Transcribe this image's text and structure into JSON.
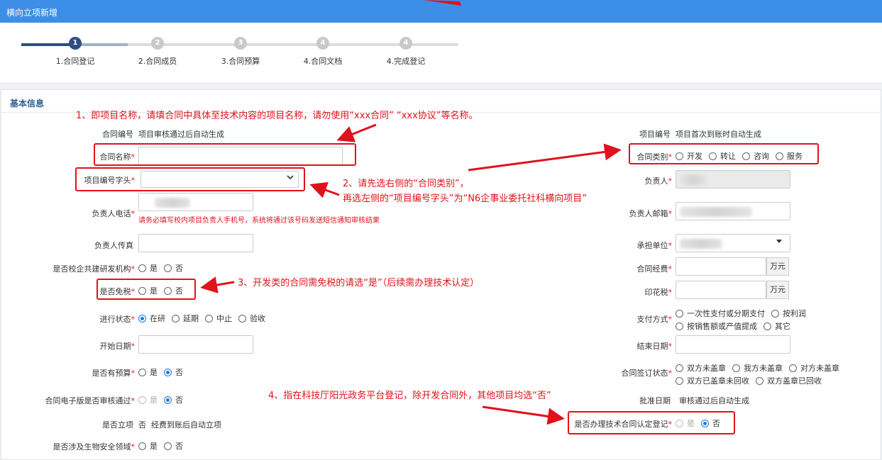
{
  "window": {
    "title": "横向立项新增"
  },
  "steps": [
    {
      "num": "1",
      "label": "1.合同登记"
    },
    {
      "num": "2",
      "label": "2.合同成员"
    },
    {
      "num": "3",
      "label": "3.合同预算"
    },
    {
      "num": "4",
      "label": "4.合同文档"
    },
    {
      "num": "4",
      "label": "4.完成登记"
    }
  ],
  "section": {
    "title": "基本信息"
  },
  "left": {
    "contract_no": {
      "label": "合同编号",
      "value": "项目审核通过后自动生成"
    },
    "contract_name": {
      "label": "合同名称",
      "value": ""
    },
    "project_prefix": {
      "label": "项目编号字头",
      "value": ""
    },
    "leader_phone": {
      "label": "负责人电话",
      "hint": "请务必填写校内项目负责人手机号，系统将通过该号码发送短信通知审核结果"
    },
    "leader_fax": {
      "label": "负责人传真",
      "value": ""
    },
    "joint_rd": {
      "label": "是否校企共建研发机构",
      "options": [
        "是",
        "否"
      ]
    },
    "tax_free": {
      "label": "是否免税",
      "options": [
        "是",
        "否"
      ]
    },
    "status": {
      "label": "进行状态",
      "options": [
        "在研",
        "延期",
        "中止",
        "验收"
      ]
    },
    "start_date": {
      "label": "开始日期",
      "value": ""
    },
    "has_budget": {
      "label": "是否有预算",
      "options": [
        "是",
        "否"
      ]
    },
    "e_version": {
      "label": "合同电子版是否审核通过",
      "options": [
        "是",
        "否"
      ]
    },
    "established": {
      "label": "是否立项",
      "value": "否",
      "note": "经费到账后自动立项"
    },
    "biosafety": {
      "label": "是否涉及生物安全领域",
      "options": [
        "是",
        "否"
      ]
    }
  },
  "right": {
    "project_no": {
      "label": "项目编号",
      "value": "项目首次到账时自动生成"
    },
    "contract_type": {
      "label": "合同类别",
      "options": [
        "开发",
        "转让",
        "咨询",
        "服务"
      ]
    },
    "leader": {
      "label": "负责人"
    },
    "leader_email": {
      "label": "负责人邮箱"
    },
    "unit": {
      "label": "承担单位"
    },
    "funds": {
      "label": "合同经费",
      "unit": "万元"
    },
    "stamp_tax": {
      "label": "印花税",
      "unit": "万元"
    },
    "payment": {
      "label": "支付方式",
      "options": [
        "一次性支付或分期支付",
        "按利润",
        "按销售额或产值提成",
        "其它"
      ]
    },
    "end_date": {
      "label": "结束日期",
      "value": ""
    },
    "sign_status": {
      "label": "合同签订状态",
      "options": [
        "双方未盖章",
        "我方未盖章",
        "对方未盖章",
        "双方已盖章未回收",
        "双方盖章已回收"
      ]
    },
    "approve_date": {
      "label": "批准日期",
      "value": "审核通过后自动生成"
    },
    "tech_reg": {
      "label": "是否办理技术合同认定登记",
      "options": [
        "是",
        "否"
      ]
    }
  },
  "annotations": {
    "a1": "1、即项目名称，请填合同中具体至技术内容的项目名称，请勿使用“xxx合同” “xxx协议”等名称。",
    "a2_line1": "2、请先选右侧的“合同类别”，",
    "a2_line2": "再选左侧的“项目编号字头”为“N6企事业委托社科横向项目”",
    "a3": "3、开发类的合同需免税的请选“是”（后续需办理技术认定）",
    "a4": "4、指在科技厅阳光政务平台登记，除开发合同外，其他项目均选“否”"
  },
  "colors": {
    "titlebar": "#3d8ee7",
    "accent": "#2e4e7e",
    "annotation": "#e0121b",
    "radio_selected": "#1e78e6"
  }
}
